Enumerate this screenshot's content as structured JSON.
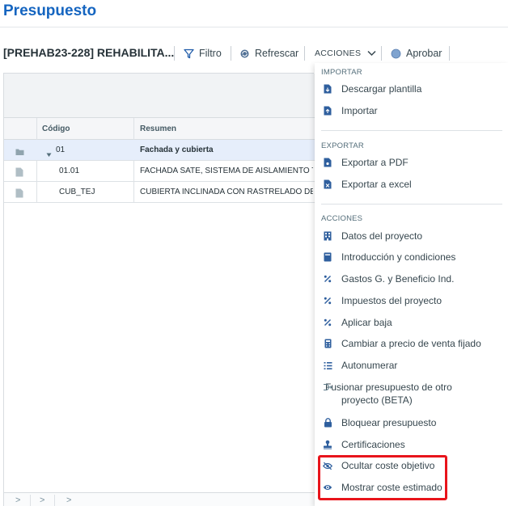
{
  "page": {
    "title": "Presupuesto"
  },
  "toolbar": {
    "project_name": "[PREHAB23-228] REHABILITA...",
    "filter_label": "Filtro",
    "refresh_label": "Refrescar",
    "actions_label": "ACCIONES",
    "approve_label": "Aprobar"
  },
  "grid": {
    "columns": {
      "code": "Código",
      "summary": "Resumen"
    },
    "rows": [
      {
        "code": "01",
        "summary": "Fachada y cubierta",
        "icon": "folder-icon"
      },
      {
        "code": "01.01",
        "summary": "FACHADA SATE, SISTEMA DE AISLAMIENTO TE",
        "icon": "document-icon"
      },
      {
        "code": "CUB_TEJ",
        "summary": "CUBIERTA INCLINADA CON RASTRELADO DE M",
        "icon": "document-icon"
      }
    ],
    "pager": [
      ">",
      ">",
      ">"
    ]
  },
  "menu": {
    "importar": {
      "title": "IMPORTAR",
      "items": [
        {
          "label": "Descargar plantilla",
          "icon": "file-download-icon"
        },
        {
          "label": "Importar",
          "icon": "file-import-icon"
        }
      ]
    },
    "exportar": {
      "title": "EXPORTAR",
      "items": [
        {
          "label": "Exportar a PDF",
          "icon": "file-pdf-icon"
        },
        {
          "label": "Exportar a excel",
          "icon": "file-excel-icon"
        }
      ]
    },
    "acciones": {
      "title": "ACCIONES",
      "items": [
        {
          "label": "Datos del proyecto",
          "icon": "building-icon"
        },
        {
          "label": "Introducción y condiciones",
          "icon": "notebook-icon"
        },
        {
          "label": "Gastos G. y Beneficio Ind.",
          "icon": "percent-icon"
        },
        {
          "label": "Impuestos del proyecto",
          "icon": "percent-icon"
        },
        {
          "label": "Aplicar baja",
          "icon": "percent-icon"
        },
        {
          "label": "Cambiar a precio de venta fijado",
          "icon": "calculator-icon"
        },
        {
          "label": "Autonumerar",
          "icon": "numbered-list-icon"
        },
        {
          "label": "Fusionar presupuesto de otro proyecto (BETA)",
          "icon": "merge-icon"
        },
        {
          "label": "Bloquear presupuesto",
          "icon": "lock-icon"
        },
        {
          "label": "Certificaciones",
          "icon": "stamp-icon"
        },
        {
          "label": "Ocultar coste objetivo",
          "icon": "eye-off-icon"
        },
        {
          "label": "Mostrar coste estimado",
          "icon": "eye-icon"
        }
      ]
    }
  },
  "colors": {
    "brand_blue": "#1565c0",
    "icon_blue": "#2f5f9e",
    "highlight_red": "#e8141b",
    "selected_row": "#e6eefb"
  }
}
